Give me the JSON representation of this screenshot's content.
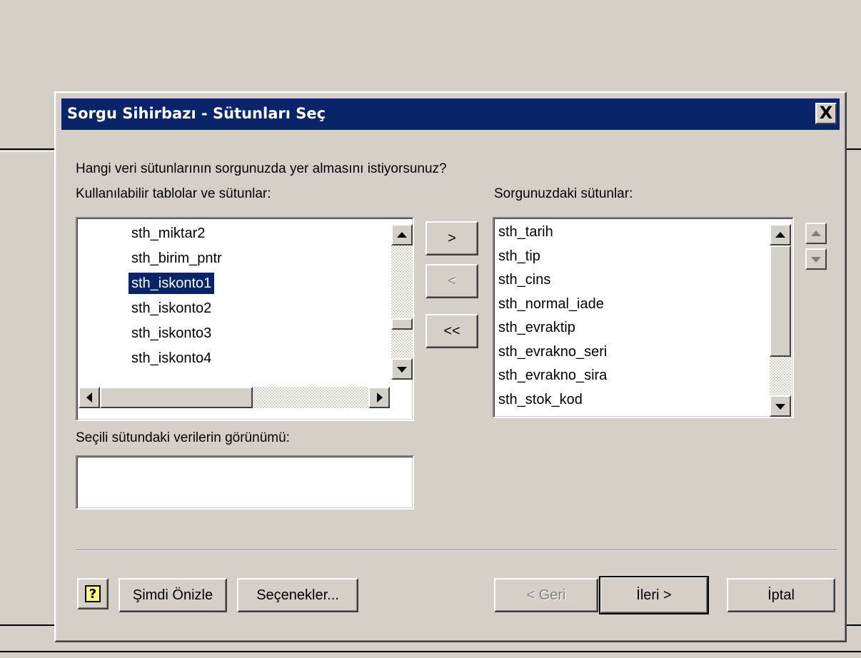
{
  "dialog": {
    "title": "Sorgu Sihirbazı - Sütunları Seç",
    "close_label": "X",
    "question": "Hangi veri sütunlarının sorgunuzda yer almasını istiyorsunuz?",
    "available_label": "Kullanılabilir tablolar ve sütunlar:",
    "selected_label": "Sorgunuzdaki sütunlar:",
    "preview_label": "Seçili sütundaki verilerin görünümü:",
    "preview_value": ""
  },
  "available_columns": [
    {
      "label": "sth_miktar2",
      "selected": false
    },
    {
      "label": "sth_birim_pntr",
      "selected": false
    },
    {
      "label": "sth_iskonto1",
      "selected": true
    },
    {
      "label": "sth_iskonto2",
      "selected": false
    },
    {
      "label": "sth_iskonto3",
      "selected": false
    },
    {
      "label": "sth_iskonto4",
      "selected": false
    }
  ],
  "query_columns": [
    "sth_tarih",
    "sth_tip",
    "sth_cins",
    "sth_normal_iade",
    "sth_evraktip",
    "sth_evrakno_seri",
    "sth_evrakno_sira",
    "sth_stok_kod"
  ],
  "move_buttons": {
    "add": ">",
    "remove": "<",
    "remove_all": "<<"
  },
  "footer": {
    "help_icon": "?",
    "preview_now": "Şimdi Önizle",
    "options": "Seçenekler...",
    "back": "< Geri",
    "next": "İleri >",
    "cancel": "İptal"
  },
  "colors": {
    "titlebar": "#0a246a",
    "face": "#d4d0c8",
    "selection": "#0a246a"
  },
  "icons": {
    "order_up": "arrow-up-icon",
    "order_down": "arrow-down-icon",
    "help": "help-icon"
  }
}
